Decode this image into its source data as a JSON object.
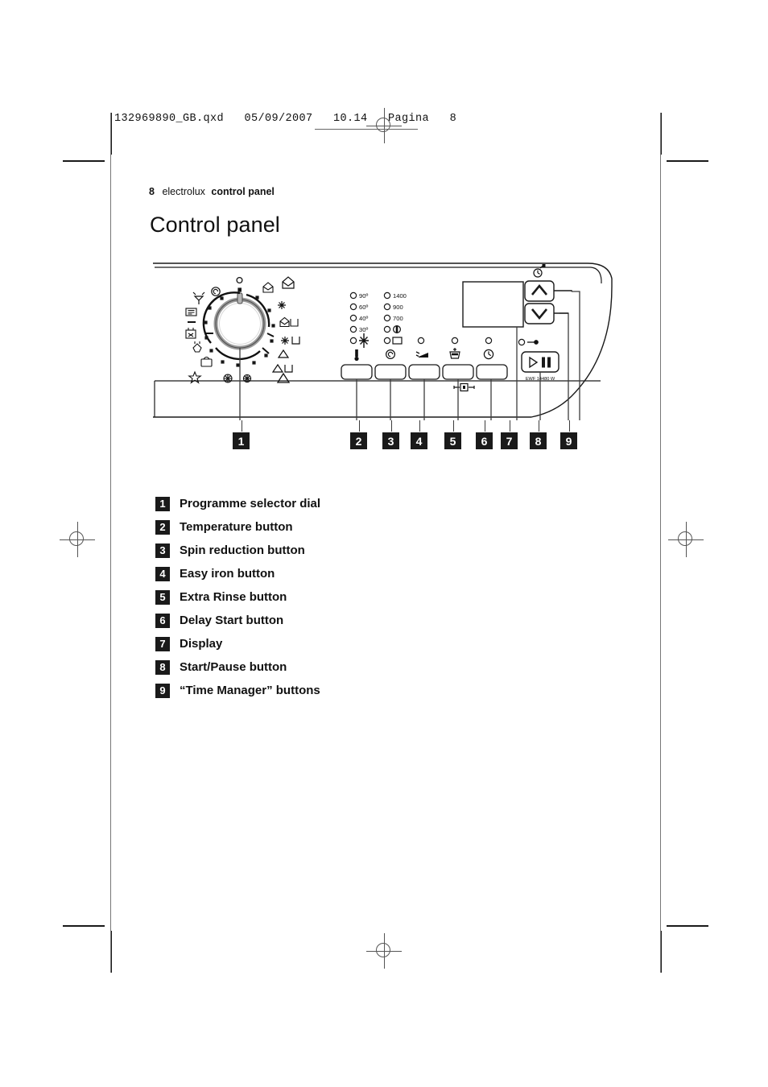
{
  "file_header": {
    "text": "132969890_GB.qxd   05/09/2007   10.14   Pagina   8"
  },
  "running_head": {
    "page_number": "8",
    "brand": "electrolux",
    "section": "control panel"
  },
  "page_title": "Control panel",
  "panel": {
    "model_label": "EWF 14480 W",
    "temperature_leds": [
      "90º",
      "60º",
      "40º",
      "30º",
      "✻"
    ],
    "spin_leds": [
      "1400",
      "900",
      "700",
      "ⓘ",
      "▭"
    ],
    "button_icons": [
      "thermometer-icon",
      "spin-spiral-icon",
      "easy-iron-icon",
      "extra-rinse-icon",
      "delay-start-clock-icon"
    ],
    "time_manager_icon": "time-manager-icon",
    "door-lock_icon": "door-locked-icon",
    "start_pause_icon": "play-pause-icon",
    "dial_symbols_left": [
      "spin-symbol",
      "drain-symbol",
      "rinse-symbol",
      "pump-out-symbol",
      "handwash-symbol",
      "wool-symbol",
      "star-symbol"
    ],
    "dial_symbols_right": [
      "cotton-symbol",
      "cotton-heavy-symbol",
      "synthetics-symbol",
      "cotton-prewash-symbol",
      "synthetics-prewash-symbol",
      "delicates-symbol",
      "delicates-prewash-symbol",
      "delicates-plain-symbol"
    ]
  },
  "callouts": [
    "1",
    "2",
    "3",
    "4",
    "5",
    "6",
    "7",
    "8",
    "9"
  ],
  "legend": [
    {
      "num": "1",
      "label": "Programme selector dial"
    },
    {
      "num": "2",
      "label": "Temperature button"
    },
    {
      "num": "3",
      "label": "Spin reduction button"
    },
    {
      "num": "4",
      "label": "Easy iron button"
    },
    {
      "num": "5",
      "label": "Extra Rinse button"
    },
    {
      "num": "6",
      "label": "Delay Start button"
    },
    {
      "num": "7",
      "label": "Display"
    },
    {
      "num": "8",
      "label": "Start/Pause button"
    },
    {
      "num": "9",
      "label": "“Time Manager” buttons"
    }
  ]
}
